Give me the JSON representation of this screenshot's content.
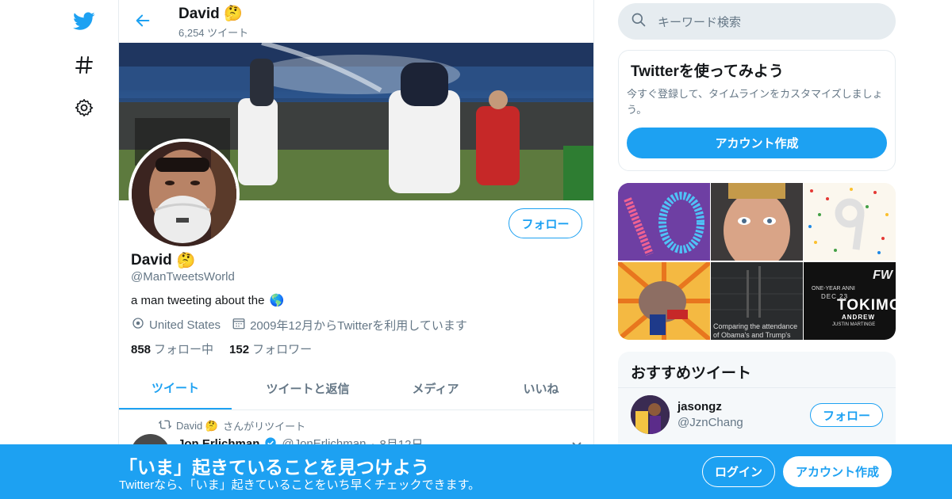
{
  "profile": {
    "name": "David",
    "name_emoji": "🤔",
    "tweet_count": "6,254 ツイート",
    "handle": "@ManTweetsWorld",
    "bio": "a man tweeting about the",
    "bio_emoji": "🌎",
    "location": "United States",
    "joined": "2009年12月からTwitterを利用しています",
    "following_count": "858",
    "following_label": "フォロー中",
    "followers_count": "152",
    "followers_label": "フォロワー",
    "follow_button": "フォロー"
  },
  "tabs": [
    {
      "label": "ツイート",
      "active": true
    },
    {
      "label": "ツイートと返信",
      "active": false
    },
    {
      "label": "メディア",
      "active": false
    },
    {
      "label": "いいね",
      "active": false
    }
  ],
  "timeline": {
    "retweet_text": "さんがリツイート",
    "retweeter": "David",
    "retweeter_emoji": "🤔",
    "tweet_author": "Jon Erlichman",
    "tweet_handle": "@JonErlichman",
    "tweet_date": "8月12日"
  },
  "search": {
    "placeholder": "キーワード検索"
  },
  "signup_card": {
    "title": "Twitterを使ってみよう",
    "desc": "今すぐ登録して、タイムラインをカスタマイズしましょう。",
    "button": "アカウント作成"
  },
  "media_grid": {
    "tile5_caption": "Comparing the attendance of Obama's and Trump's",
    "tile6_line1": "ONE-YEAR ANNI",
    "tile6_line2": "DEC 23",
    "tile6_line3": "TOKIMO",
    "tile6_line4": "ANDREW",
    "tile6_line5": "JUSTIN MARTINGE",
    "tile6_logo": "FW"
  },
  "recommended": {
    "title": "おすすめツイート",
    "user_name": "jasongz",
    "user_handle": "@JznChang",
    "follow_button": "フォロー"
  },
  "bottom_bar": {
    "title": "「いま」起きていることを見つけよう",
    "subtitle": "Twitterなら、「いま」起きていることをいち早くチェックできます。",
    "login": "ログイン",
    "signup": "アカウント作成"
  },
  "colors": {
    "accent": "#1da1f2",
    "secondary_text": "#657786",
    "border": "#e6ecf0"
  },
  "icons": [
    "twitter-logo-icon",
    "hashtag-icon",
    "gear-icon",
    "back-arrow-icon",
    "search-icon",
    "location-pin-icon",
    "calendar-icon",
    "retweet-icon",
    "verified-icon",
    "chevron-down-icon"
  ]
}
